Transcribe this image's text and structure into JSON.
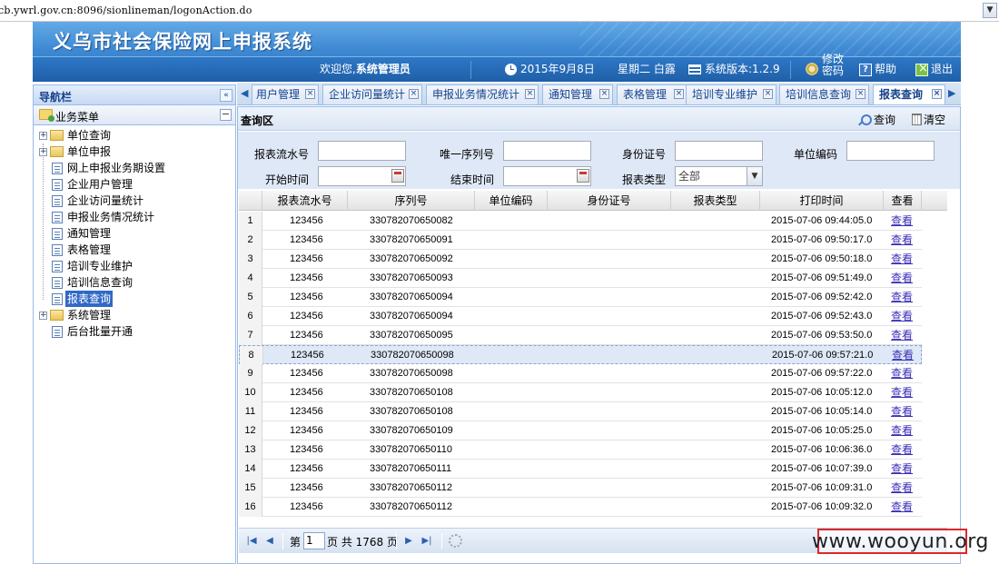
{
  "browser": {
    "url": "cb.ywrl.gov.cn:8096/sionlineman/logonAction.do"
  },
  "header": {
    "title": "义乌市社会保险网上申报系统",
    "welcome": "欢迎您,",
    "user": "系统管理员",
    "date": "2015年9月8日",
    "weekday": "星期二 白露",
    "version": "系统版本:1.2.9",
    "change_password": "修改密码",
    "help": "帮助",
    "logout": "退出"
  },
  "sidebar": {
    "title": "导航栏",
    "menu_title": "业务菜单",
    "items": [
      {
        "label": "单位查询",
        "type": "folder"
      },
      {
        "label": "单位申报",
        "type": "folder"
      },
      {
        "label": "网上申报业务期设置",
        "type": "page"
      },
      {
        "label": "企业用户管理",
        "type": "page"
      },
      {
        "label": "企业访问量统计",
        "type": "page"
      },
      {
        "label": "申报业务情况统计",
        "type": "page"
      },
      {
        "label": "通知管理",
        "type": "page"
      },
      {
        "label": "表格管理",
        "type": "page"
      },
      {
        "label": "培训专业维护",
        "type": "page"
      },
      {
        "label": "培训信息查询",
        "type": "page"
      },
      {
        "label": "报表查询",
        "type": "page",
        "selected": true
      },
      {
        "label": "系统管理",
        "type": "folder"
      },
      {
        "label": "后台批量开通",
        "type": "page"
      }
    ]
  },
  "tabs": [
    {
      "label": "用户管理"
    },
    {
      "label": "企业访问量统计"
    },
    {
      "label": "申报业务情况统计"
    },
    {
      "label": "通知管理"
    },
    {
      "label": "表格管理"
    },
    {
      "label": "培训专业维护"
    },
    {
      "label": "培训信息查询"
    },
    {
      "label": "报表查询",
      "active": true
    }
  ],
  "query": {
    "title": "查询区",
    "search": "查询",
    "clear": "清空",
    "fields": {
      "serial": "报表流水号",
      "unique_seq": "唯一序列号",
      "id_card": "身份证号",
      "unit_code": "单位编码",
      "start_time": "开始时间",
      "end_time": "结束时间",
      "report_type": "报表类型",
      "report_type_value": "全部"
    }
  },
  "table": {
    "columns": [
      "报表流水号",
      "序列号",
      "单位编码",
      "身份证号",
      "报表类型",
      "打印时间",
      "查看"
    ],
    "view_label": "查看",
    "rows": [
      {
        "n": "1",
        "serial": "123456",
        "seq": "330782070650082",
        "time": "2015-07-06 09:44:05.0"
      },
      {
        "n": "2",
        "serial": "123456",
        "seq": "330782070650091",
        "time": "2015-07-06 09:50:17.0"
      },
      {
        "n": "3",
        "serial": "123456",
        "seq": "330782070650092",
        "time": "2015-07-06 09:50:18.0"
      },
      {
        "n": "4",
        "serial": "123456",
        "seq": "330782070650093",
        "time": "2015-07-06 09:51:49.0"
      },
      {
        "n": "5",
        "serial": "123456",
        "seq": "330782070650094",
        "time": "2015-07-06 09:52:42.0"
      },
      {
        "n": "6",
        "serial": "123456",
        "seq": "330782070650094",
        "time": "2015-07-06 09:52:43.0"
      },
      {
        "n": "7",
        "serial": "123456",
        "seq": "330782070650095",
        "time": "2015-07-06 09:53:50.0"
      },
      {
        "n": "8",
        "serial": "123456",
        "seq": "330782070650098",
        "time": "2015-07-06 09:57:21.0",
        "highlight": true
      },
      {
        "n": "9",
        "serial": "123456",
        "seq": "330782070650098",
        "time": "2015-07-06 09:57:22.0"
      },
      {
        "n": "10",
        "serial": "123456",
        "seq": "330782070650108",
        "time": "2015-07-06 10:05:12.0"
      },
      {
        "n": "11",
        "serial": "123456",
        "seq": "330782070650108",
        "time": "2015-07-06 10:05:14.0"
      },
      {
        "n": "12",
        "serial": "123456",
        "seq": "330782070650109",
        "time": "2015-07-06 10:05:25.0"
      },
      {
        "n": "13",
        "serial": "123456",
        "seq": "330782070650110",
        "time": "2015-07-06 10:06:36.0"
      },
      {
        "n": "14",
        "serial": "123456",
        "seq": "330782070650111",
        "time": "2015-07-06 10:07:39.0"
      },
      {
        "n": "15",
        "serial": "123456",
        "seq": "330782070650112",
        "time": "2015-07-06 10:09:31.0"
      },
      {
        "n": "16",
        "serial": "123456",
        "seq": "330782070650112",
        "time": "2015-07-06 10:09:32.0"
      }
    ]
  },
  "pager": {
    "prefix": "第",
    "page": "1",
    "total": "页 共 1768 页"
  },
  "watermark": "www.wooyun.org",
  "colors": {
    "header_blue": "#2c73c0",
    "panel_border": "#99bbe8",
    "link": "#3b2fb8",
    "watermark_border": "#e0262a"
  }
}
